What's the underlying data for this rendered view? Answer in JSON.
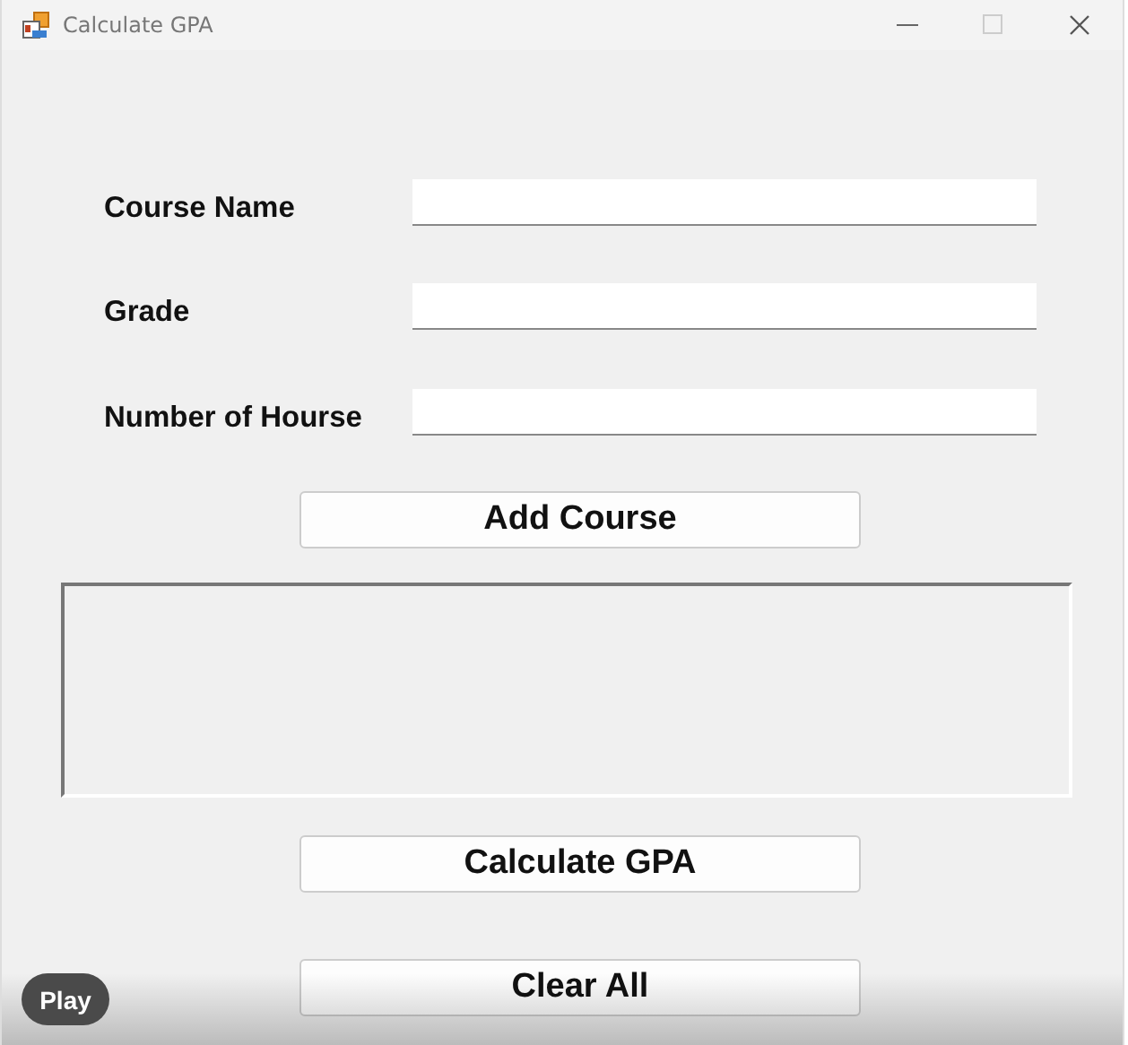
{
  "window": {
    "title": "Calculate GPA"
  },
  "fields": [
    {
      "label": "Course Name"
    },
    {
      "label": "Grade"
    },
    {
      "label": "Number of Hourse"
    }
  ],
  "add_button": "Add Course",
  "calculate_button": "Calculate GPA",
  "clear_button": "Clear All",
  "player": {
    "play_button": "Play"
  }
}
